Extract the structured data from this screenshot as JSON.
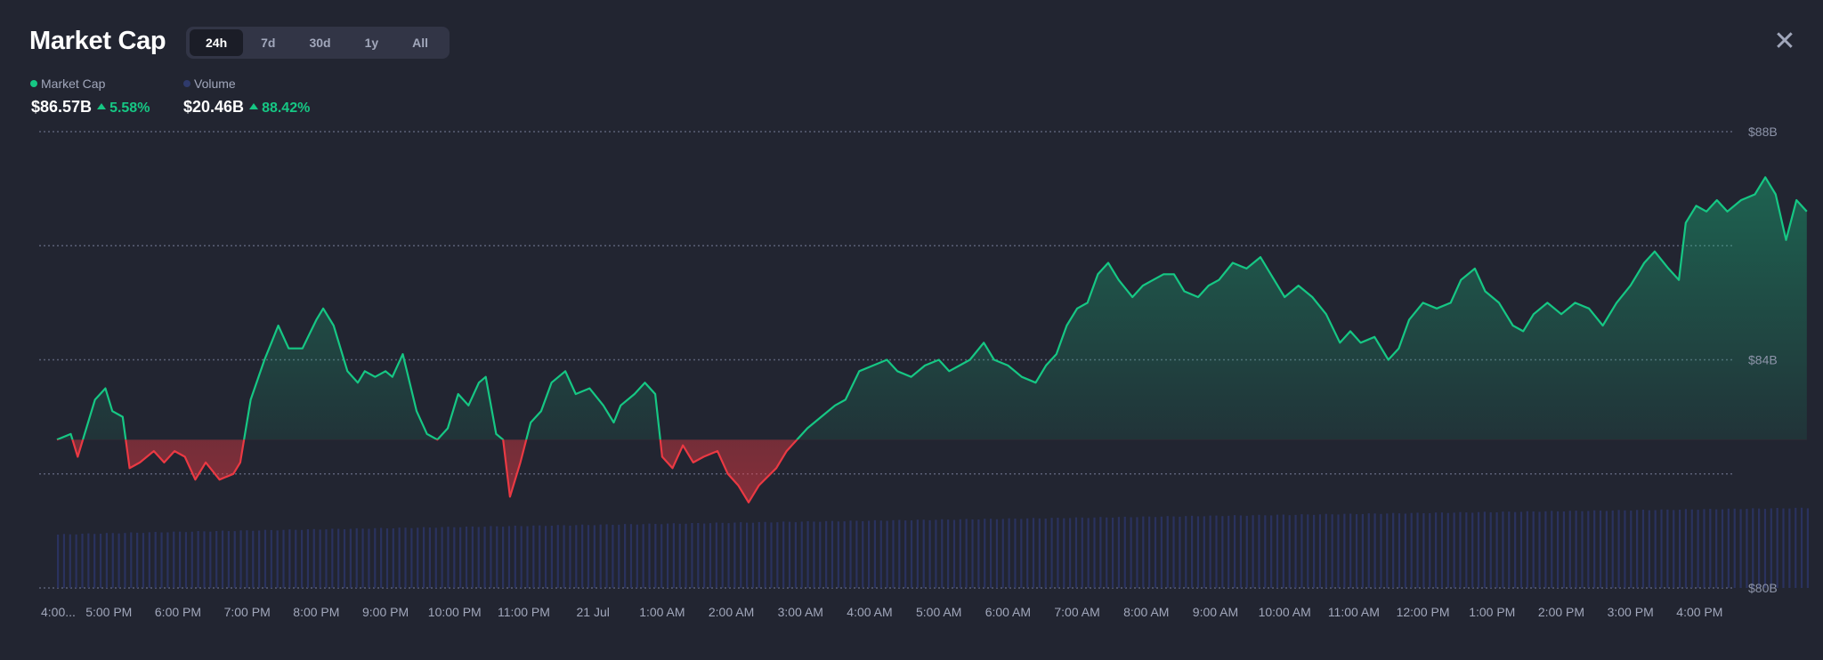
{
  "header": {
    "title": "Market Cap",
    "tabs": [
      {
        "label": "24h",
        "active": true
      },
      {
        "label": "7d",
        "active": false
      },
      {
        "label": "30d",
        "active": false
      },
      {
        "label": "1y",
        "active": false
      },
      {
        "label": "All",
        "active": false
      }
    ],
    "close_icon": "close-icon"
  },
  "legend": {
    "market_cap": {
      "label": "Market Cap",
      "color": "#16c784",
      "value": "$86.57B",
      "change": "5.58%"
    },
    "volume": {
      "label": "Volume",
      "color": "#2f3a6b",
      "value": "$20.46B",
      "change": "88.42%"
    }
  },
  "colors": {
    "up": "#16c784",
    "down": "#ea3943",
    "volume": "#2c3566",
    "background": "#222531"
  },
  "chart_data": {
    "type": "area",
    "title": "Market Cap",
    "baseline": 82.6,
    "ylim": [
      80,
      88
    ],
    "y_ticks": [
      "$88B",
      "$84B",
      "$80B"
    ],
    "y_tick_values": [
      88,
      84,
      80
    ],
    "gridlines": [
      88,
      86.0,
      84,
      82.0,
      80
    ],
    "x_tick_labels": [
      "4:00...",
      "5:00 PM",
      "6:00 PM",
      "7:00 PM",
      "8:00 PM",
      "9:00 PM",
      "10:00 PM",
      "11:00 PM",
      "21 Jul",
      "1:00 AM",
      "2:00 AM",
      "3:00 AM",
      "4:00 AM",
      "5:00 AM",
      "6:00 AM",
      "7:00 AM",
      "8:00 AM",
      "9:00 AM",
      "10:00 AM",
      "11:00 AM",
      "12:00 PM",
      "1:00 PM",
      "2:00 PM",
      "3:00 PM",
      "4:00 PM"
    ],
    "x_hours": [
      0,
      0.75,
      1.75,
      2.75,
      3.75,
      4.75,
      5.75,
      6.75,
      7.75,
      8.75,
      9.75,
      10.75,
      11.75,
      12.75,
      13.75,
      14.75,
      15.75,
      16.75,
      17.75,
      18.75,
      19.75,
      20.75,
      21.75,
      22.75,
      23.75
    ],
    "series": [
      {
        "name": "Market Cap",
        "unit": "$B",
        "points": [
          [
            0.0,
            82.6
          ],
          [
            0.2,
            82.7
          ],
          [
            0.3,
            82.3
          ],
          [
            0.55,
            83.3
          ],
          [
            0.7,
            83.5
          ],
          [
            0.8,
            83.1
          ],
          [
            0.95,
            83.0
          ],
          [
            1.05,
            82.1
          ],
          [
            1.2,
            82.2
          ],
          [
            1.4,
            82.4
          ],
          [
            1.55,
            82.2
          ],
          [
            1.7,
            82.4
          ],
          [
            1.85,
            82.3
          ],
          [
            2.0,
            81.9
          ],
          [
            2.15,
            82.2
          ],
          [
            2.35,
            81.9
          ],
          [
            2.55,
            82.0
          ],
          [
            2.65,
            82.2
          ],
          [
            2.8,
            83.3
          ],
          [
            3.0,
            84.0
          ],
          [
            3.1,
            84.3
          ],
          [
            3.2,
            84.6
          ],
          [
            3.35,
            84.2
          ],
          [
            3.55,
            84.2
          ],
          [
            3.75,
            84.7
          ],
          [
            3.85,
            84.9
          ],
          [
            4.0,
            84.6
          ],
          [
            4.2,
            83.8
          ],
          [
            4.35,
            83.6
          ],
          [
            4.45,
            83.8
          ],
          [
            4.6,
            83.7
          ],
          [
            4.75,
            83.8
          ],
          [
            4.85,
            83.7
          ],
          [
            5.0,
            84.1
          ],
          [
            5.2,
            83.1
          ],
          [
            5.35,
            82.7
          ],
          [
            5.5,
            82.6
          ],
          [
            5.65,
            82.8
          ],
          [
            5.8,
            83.4
          ],
          [
            5.95,
            83.2
          ],
          [
            6.1,
            83.6
          ],
          [
            6.2,
            83.7
          ],
          [
            6.35,
            82.7
          ],
          [
            6.45,
            82.6
          ],
          [
            6.55,
            81.6
          ],
          [
            6.7,
            82.2
          ],
          [
            6.85,
            82.9
          ],
          [
            7.0,
            83.1
          ],
          [
            7.15,
            83.6
          ],
          [
            7.35,
            83.8
          ],
          [
            7.5,
            83.4
          ],
          [
            7.7,
            83.5
          ],
          [
            7.9,
            83.2
          ],
          [
            8.05,
            82.9
          ],
          [
            8.15,
            83.2
          ],
          [
            8.35,
            83.4
          ],
          [
            8.5,
            83.6
          ],
          [
            8.65,
            83.4
          ],
          [
            8.75,
            82.3
          ],
          [
            8.9,
            82.1
          ],
          [
            9.05,
            82.5
          ],
          [
            9.2,
            82.2
          ],
          [
            9.35,
            82.3
          ],
          [
            9.55,
            82.4
          ],
          [
            9.7,
            82.0
          ],
          [
            9.85,
            81.8
          ],
          [
            10.0,
            81.5
          ],
          [
            10.15,
            81.8
          ],
          [
            10.4,
            82.1
          ],
          [
            10.55,
            82.4
          ],
          [
            10.7,
            82.6
          ],
          [
            10.85,
            82.8
          ],
          [
            11.05,
            83.0
          ],
          [
            11.25,
            83.2
          ],
          [
            11.4,
            83.3
          ],
          [
            11.6,
            83.8
          ],
          [
            11.8,
            83.9
          ],
          [
            12.0,
            84.0
          ],
          [
            12.15,
            83.8
          ],
          [
            12.35,
            83.7
          ],
          [
            12.55,
            83.9
          ],
          [
            12.75,
            84.0
          ],
          [
            12.9,
            83.8
          ],
          [
            13.05,
            83.9
          ],
          [
            13.2,
            84.0
          ],
          [
            13.4,
            84.3
          ],
          [
            13.55,
            84.0
          ],
          [
            13.75,
            83.9
          ],
          [
            13.95,
            83.7
          ],
          [
            14.15,
            83.6
          ],
          [
            14.3,
            83.9
          ],
          [
            14.45,
            84.1
          ],
          [
            14.6,
            84.6
          ],
          [
            14.75,
            84.9
          ],
          [
            14.9,
            85.0
          ],
          [
            15.05,
            85.5
          ],
          [
            15.2,
            85.7
          ],
          [
            15.35,
            85.4
          ],
          [
            15.55,
            85.1
          ],
          [
            15.7,
            85.3
          ],
          [
            15.85,
            85.4
          ],
          [
            16.0,
            85.5
          ],
          [
            16.15,
            85.5
          ],
          [
            16.3,
            85.2
          ],
          [
            16.5,
            85.1
          ],
          [
            16.65,
            85.3
          ],
          [
            16.8,
            85.4
          ],
          [
            17.0,
            85.7
          ],
          [
            17.2,
            85.6
          ],
          [
            17.4,
            85.8
          ],
          [
            17.55,
            85.5
          ],
          [
            17.75,
            85.1
          ],
          [
            17.95,
            85.3
          ],
          [
            18.15,
            85.1
          ],
          [
            18.35,
            84.8
          ],
          [
            18.55,
            84.3
          ],
          [
            18.7,
            84.5
          ],
          [
            18.85,
            84.3
          ],
          [
            19.05,
            84.4
          ],
          [
            19.25,
            84.0
          ],
          [
            19.4,
            84.2
          ],
          [
            19.55,
            84.7
          ],
          [
            19.75,
            85.0
          ],
          [
            19.95,
            84.9
          ],
          [
            20.15,
            85.0
          ],
          [
            20.3,
            85.4
          ],
          [
            20.5,
            85.6
          ],
          [
            20.65,
            85.2
          ],
          [
            20.85,
            85.0
          ],
          [
            21.05,
            84.6
          ],
          [
            21.2,
            84.5
          ],
          [
            21.35,
            84.8
          ],
          [
            21.55,
            85.0
          ],
          [
            21.75,
            84.8
          ],
          [
            21.95,
            85.0
          ],
          [
            22.15,
            84.9
          ],
          [
            22.35,
            84.6
          ],
          [
            22.55,
            85.0
          ],
          [
            22.75,
            85.3
          ],
          [
            22.95,
            85.7
          ],
          [
            23.1,
            85.9
          ],
          [
            23.3,
            85.6
          ],
          [
            23.45,
            85.4
          ],
          [
            23.55,
            86.4
          ],
          [
            23.7,
            86.7
          ],
          [
            23.85,
            86.6
          ],
          [
            24.0,
            86.8
          ],
          [
            24.15,
            86.6
          ],
          [
            24.35,
            86.8
          ],
          [
            24.55,
            86.9
          ],
          [
            24.7,
            87.2
          ],
          [
            24.85,
            86.9
          ],
          [
            25.0,
            86.1
          ],
          [
            25.15,
            86.8
          ],
          [
            25.3,
            86.6
          ]
        ]
      },
      {
        "name": "Volume",
        "unit": "$B",
        "min": 10.86,
        "max": 20.46
      }
    ]
  }
}
